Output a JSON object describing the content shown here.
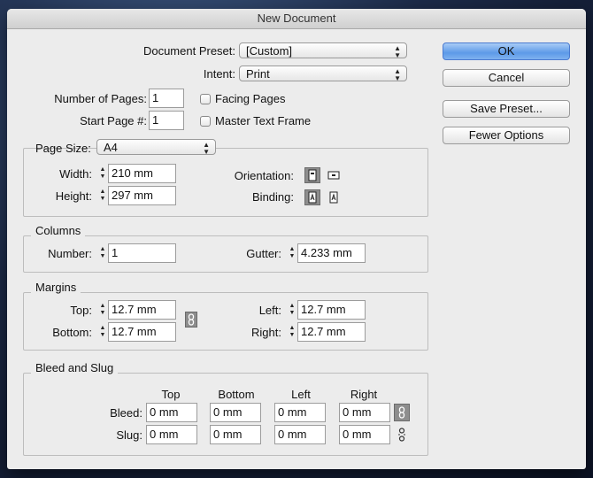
{
  "window": {
    "title": "New Document"
  },
  "preset": {
    "label": "Document Preset:",
    "value": "[Custom]"
  },
  "intent": {
    "label": "Intent:",
    "value": "Print"
  },
  "pages": {
    "label": "Number of Pages:",
    "value": "1"
  },
  "start_page": {
    "label": "Start Page #:",
    "value": "1"
  },
  "facing_pages": {
    "label": "Facing Pages",
    "checked": false
  },
  "master_text_frame": {
    "label": "Master Text Frame",
    "checked": false
  },
  "page_size": {
    "label": "Page Size:",
    "value": "A4",
    "width_label": "Width:",
    "width": "210 mm",
    "height_label": "Height:",
    "height": "297 mm",
    "orientation_label": "Orientation:",
    "binding_label": "Binding:"
  },
  "columns": {
    "title": "Columns",
    "number_label": "Number:",
    "number": "1",
    "gutter_label": "Gutter:",
    "gutter": "4.233 mm"
  },
  "margins": {
    "title": "Margins",
    "top_label": "Top:",
    "top": "12.7 mm",
    "bottom_label": "Bottom:",
    "bottom": "12.7 mm",
    "left_label": "Left:",
    "left": "12.7 mm",
    "right_label": "Right:",
    "right": "12.7 mm"
  },
  "bleed_slug": {
    "title": "Bleed and Slug",
    "headers": [
      "Top",
      "Bottom",
      "Left",
      "Right"
    ],
    "bleed_label": "Bleed:",
    "bleed": [
      "0 mm",
      "0 mm",
      "0 mm",
      "0 mm"
    ],
    "slug_label": "Slug:",
    "slug": [
      "0 mm",
      "0 mm",
      "0 mm",
      "0 mm"
    ]
  },
  "buttons": {
    "ok": "OK",
    "cancel": "Cancel",
    "save_preset": "Save Preset...",
    "fewer_options": "Fewer Options"
  },
  "icons": {
    "portrait": "portrait-orientation-icon",
    "landscape": "landscape-orientation-icon",
    "ltr": "left-to-right-binding-icon",
    "rtl": "right-to-left-binding-icon",
    "link": "chain-link-icon"
  }
}
